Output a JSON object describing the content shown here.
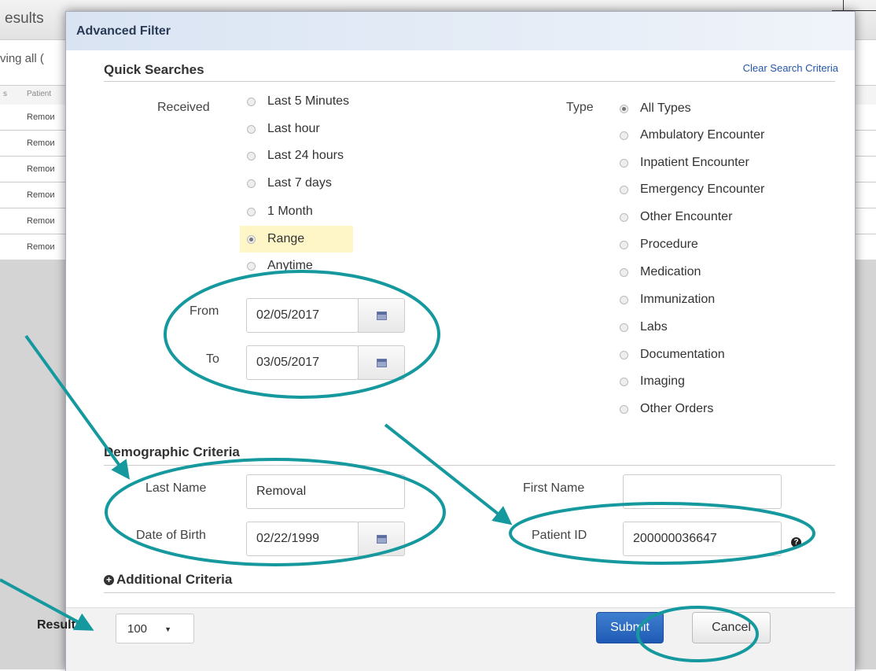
{
  "background": {
    "title_fragment": "esults",
    "showing_fragment": "ving all (",
    "column_headers": [
      "s",
      "Patient"
    ],
    "rows": [
      "Remoи",
      "Remoи",
      "Remoи",
      "Remoи",
      "Remoи",
      "Remoи"
    ]
  },
  "dialog": {
    "title": "Advanced Filter",
    "quick_searches": {
      "heading": "Quick Searches",
      "clear_link": "Clear Search Criteria",
      "received_label": "Received",
      "received_options": [
        {
          "label": "Last 5 Minutes",
          "selected": false
        },
        {
          "label": "Last hour",
          "selected": false
        },
        {
          "label": "Last 24 hours",
          "selected": false
        },
        {
          "label": "Last 7 days",
          "selected": false
        },
        {
          "label": "1 Month",
          "selected": false
        },
        {
          "label": "Range",
          "selected": true
        },
        {
          "label": "Anytime",
          "selected": false
        }
      ],
      "from_label": "From",
      "from_value": "02/05/2017",
      "to_label": "To",
      "to_value": "03/05/2017",
      "type_label": "Type",
      "type_options": [
        {
          "label": "All Types",
          "selected": true
        },
        {
          "label": "Ambulatory Encounter",
          "selected": false
        },
        {
          "label": "Inpatient Encounter",
          "selected": false
        },
        {
          "label": "Emergency Encounter",
          "selected": false
        },
        {
          "label": "Other Encounter",
          "selected": false
        },
        {
          "label": "Procedure",
          "selected": false
        },
        {
          "label": "Medication",
          "selected": false
        },
        {
          "label": "Immunization",
          "selected": false
        },
        {
          "label": "Labs",
          "selected": false
        },
        {
          "label": "Documentation",
          "selected": false
        },
        {
          "label": "Imaging",
          "selected": false
        },
        {
          "label": "Other Orders",
          "selected": false
        }
      ]
    },
    "demographic": {
      "heading": "Demographic Criteria",
      "last_name_label": "Last Name",
      "last_name_value": "Removal",
      "dob_label": "Date of Birth",
      "dob_value": "02/22/1999",
      "first_name_label": "First Name",
      "first_name_value": "",
      "patient_id_label": "Patient ID",
      "patient_id_value": "200000036647",
      "help_icon": "question-circle-icon"
    },
    "additional_criteria": "Additional Criteria",
    "footer": {
      "results_label": "Results",
      "results_value": "100",
      "submit_label": "Submit",
      "cancel_label": "Cancel"
    }
  },
  "colors": {
    "annotation_teal": "#16999e",
    "submit_blue": "#2a67c2",
    "link_blue": "#2356a8",
    "range_highlight": "#fff6c8"
  }
}
